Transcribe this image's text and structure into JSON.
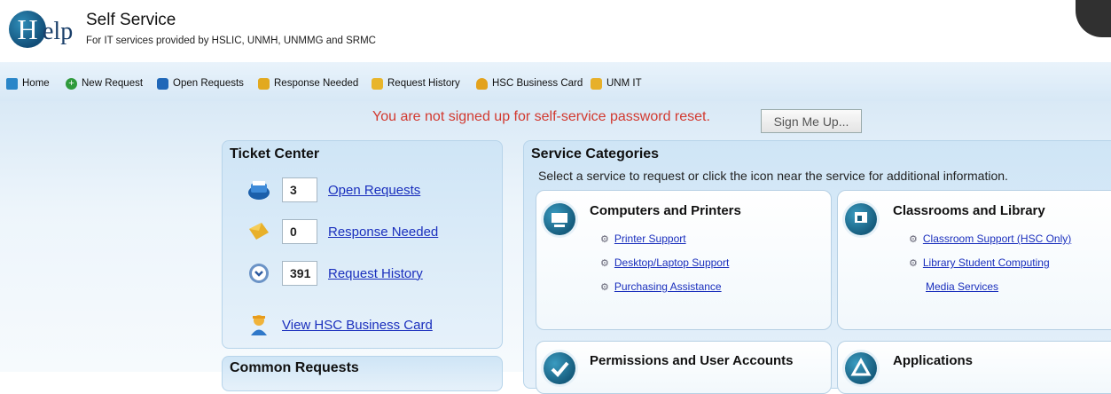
{
  "header": {
    "logo_letter": "H",
    "logo_rest": "elp",
    "title": "Self Service",
    "subtitle": "For IT services provided by HSLIC, UNMH, UNMMG and SRMC"
  },
  "nav": {
    "items": [
      {
        "label": "Home",
        "icon": "home-icon"
      },
      {
        "label": "New Request",
        "icon": "plus-circle-icon"
      },
      {
        "label": "Open Requests",
        "icon": "inbox-icon"
      },
      {
        "label": "Response Needed",
        "icon": "envelope-icon"
      },
      {
        "label": "Request History",
        "icon": "folder-icon"
      },
      {
        "label": "HSC Business Card",
        "icon": "person-icon"
      },
      {
        "label": "UNM IT",
        "icon": "pointing-hand-icon"
      }
    ]
  },
  "signup": {
    "message": "You are not signed up for self-service password reset.",
    "button_label": "Sign Me Up..."
  },
  "ticket_center": {
    "title": "Ticket Center",
    "rows": [
      {
        "count": "3",
        "label": "Open Requests",
        "icon": "inbox-icon"
      },
      {
        "count": "0",
        "label": "Response Needed",
        "icon": "envelope-icon"
      },
      {
        "count": "391",
        "label": "Request History",
        "icon": "clock-icon"
      }
    ],
    "business_card_label": "View HSC Business Card"
  },
  "common_requests": {
    "title": "Common Requests"
  },
  "service_categories": {
    "title": "Service Categories",
    "instructions": "Select a service to request or click the icon near the service for additional information.",
    "cards": [
      {
        "title": "Computers and Printers",
        "icon": "computer-icon",
        "services": [
          "Printer Support",
          "Desktop/Laptop Support",
          "Purchasing Assistance"
        ]
      },
      {
        "title": "Classrooms and Library",
        "icon": "presentation-icon",
        "services": [
          "Classroom Support (HSC Only)",
          "Library Student Computing",
          "Media Services"
        ]
      },
      {
        "title": "Permissions and User Accounts",
        "icon": "checkmark-icon"
      },
      {
        "title": "Applications",
        "icon": "app-store-icon"
      }
    ]
  },
  "colors": {
    "alert": "#d2392f",
    "link": "#1a2fbd",
    "panel_bg": "#cfe5f6"
  }
}
